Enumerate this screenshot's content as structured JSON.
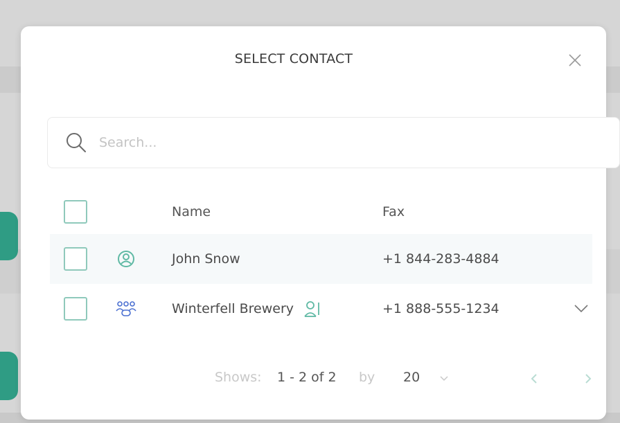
{
  "dialog": {
    "title": "SELECT CONTACT",
    "close_icon": "close-icon"
  },
  "search": {
    "placeholder": "Search...",
    "value": "",
    "icon": "search-icon"
  },
  "table": {
    "columns": {
      "name": "Name",
      "fax": "Fax"
    },
    "rows": [
      {
        "name": "John Snow",
        "fax": "+1 844-283-4884",
        "type_icon": "user-circle-icon",
        "checked": false
      },
      {
        "name": "Winterfell Brewery",
        "fax": "+1 888-555-1234",
        "type_icon": "group-icon",
        "member_icon": "users-icon",
        "expand_icon": "chevron-down-icon",
        "checked": false
      }
    ]
  },
  "pagination": {
    "shows_label": "Shows:",
    "range": "1 - 2 of 2",
    "by_label": "by",
    "page_size": "20",
    "prev_icon": "chevron-left-icon",
    "next_icon": "chevron-right-icon"
  },
  "colors": {
    "accent": "#5fb9a4",
    "checkbox_border": "#8fc9bb",
    "muted_text": "#c8c8c8",
    "backdrop_tab": "#2f9c84"
  }
}
